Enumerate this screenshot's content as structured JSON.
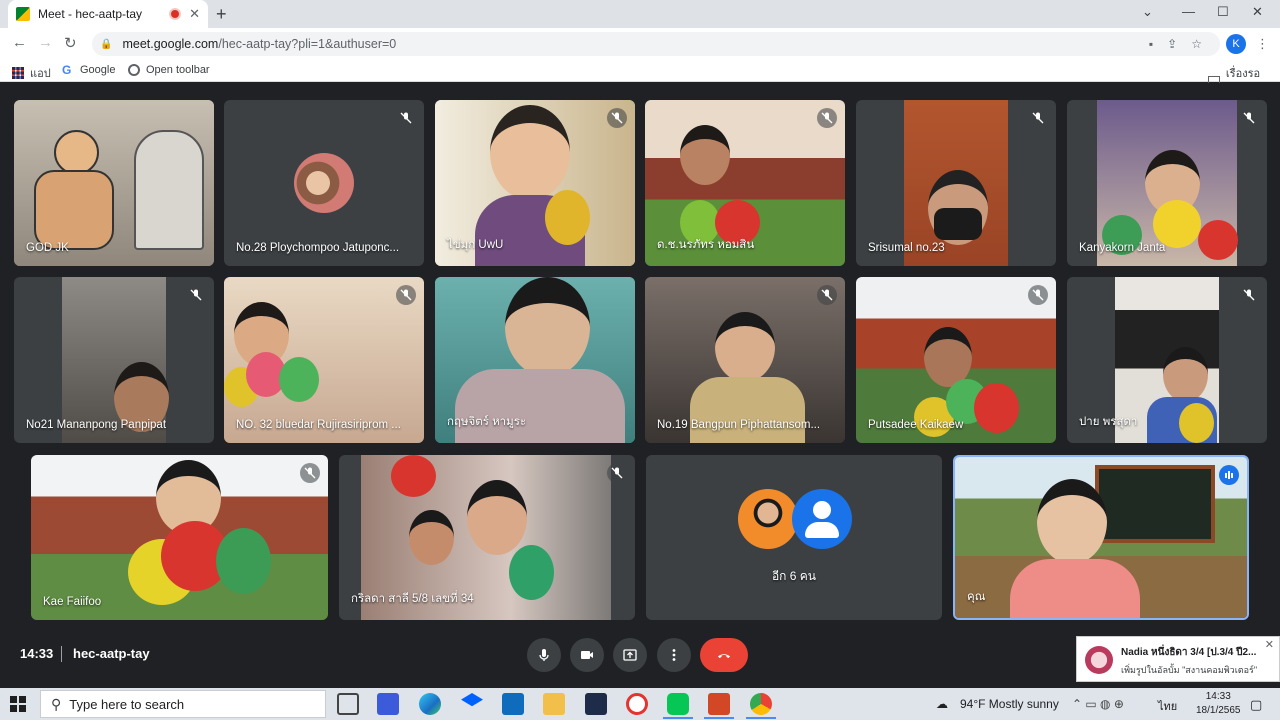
{
  "browser": {
    "tab_title": "Meet - hec-aatp-tay",
    "tab_close": "✕",
    "new_tab": "+",
    "url_host": "meet.google.com",
    "url_path": "/hec-aatp-tay?pli=1&authuser=0",
    "profile_initial": "K",
    "bookmarks": [
      {
        "label": "แอป",
        "icon": "apps-grid-icon"
      },
      {
        "label": "Google",
        "icon": "google-icon"
      },
      {
        "label": "Open toolbar",
        "icon": "toolbar-icon"
      }
    ],
    "reading_list": "เรื่องรออ่าน"
  },
  "meet": {
    "participants": [
      {
        "name": "GOD JK",
        "muted": false
      },
      {
        "name": "No.28 Ploychompoo Jatuponc...",
        "muted": true
      },
      {
        "name": "ไข่มุก UwU",
        "muted": true
      },
      {
        "name": "ด.ช.นรภัทร หอมสิน",
        "muted": true
      },
      {
        "name": "Srisumal no.23",
        "muted": true
      },
      {
        "name": "Kanyakorn Janta",
        "muted": true
      },
      {
        "name": "No21 Mananpong Panpipat",
        "muted": true
      },
      {
        "name": "NO. 32 bluedar Rujirasiriprom ...",
        "muted": true
      },
      {
        "name": "กฤษจิตร์ หามูระ",
        "muted": false
      },
      {
        "name": "No.19 Bangpun Piphattansom...",
        "muted": true
      },
      {
        "name": "Putsadee Kaikaew",
        "muted": true
      },
      {
        "name": "ปาย พรสุดา",
        "muted": true
      },
      {
        "name": "Kae Faiifoo",
        "muted": true
      },
      {
        "name": "กริลดา สาลี 5/8 เลขที่ 34",
        "muted": true
      },
      {
        "name": "อีก 6 คน",
        "muted": false
      },
      {
        "name": "คุณ",
        "muted": false
      }
    ],
    "time": "14:33",
    "meeting_code": "hec-aatp-tay"
  },
  "notification": {
    "title": "Nadia หนึ่งธิดา 3/4 [ป.3/4 ปี2...",
    "body": "เพิ่มรูปในอัลบั้ม \"สงานคอมพิวเตอร์\"",
    "close": "✕"
  },
  "taskbar": {
    "search_placeholder": "Type here to search",
    "weather": "94°F  Mostly sunny",
    "lang": "ไทย",
    "clock_time": "14:33",
    "clock_date": "18/1/2565"
  },
  "colors": {
    "meet_bg": "#202124",
    "tile_bg": "#3c4043",
    "end_call": "#ea4335",
    "accent": "#1a73e8"
  }
}
